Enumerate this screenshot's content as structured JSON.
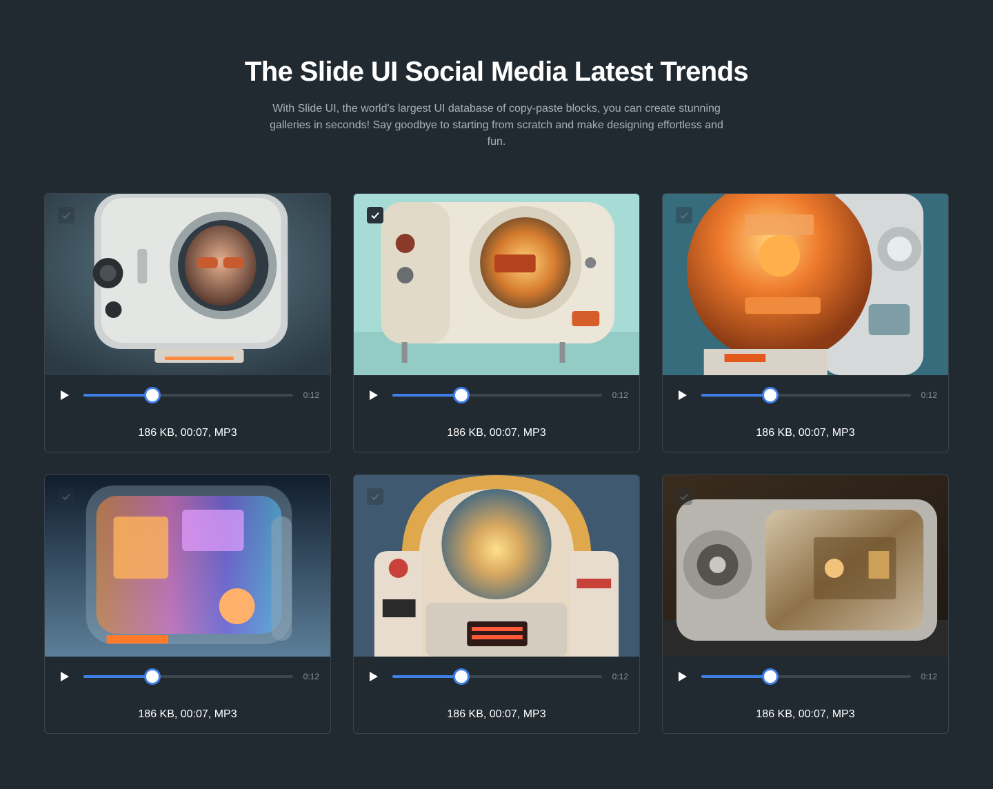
{
  "hero": {
    "title": "The Slide UI Social Media Latest Trends",
    "description": "With Slide UI, the world's largest UI database of copy-paste blocks, you can create stunning galleries in seconds! Say goodbye to starting from scratch and make designing effortless and fun."
  },
  "colors": {
    "background": "#222a31",
    "card_border": "#3b444c",
    "accent": "#3f80e8"
  },
  "cards": [
    {
      "image": "retro-tv-with-woman-face",
      "selected": false,
      "progress": 0.33,
      "duration": "0:12",
      "meta": "186 KB, 00:07, MP3"
    },
    {
      "image": "cream-retro-camera-machine",
      "selected": true,
      "progress": 0.33,
      "duration": "0:12",
      "meta": "186 KB, 00:07, MP3"
    },
    {
      "image": "orange-glass-robot-machine",
      "selected": false,
      "progress": 0.33,
      "duration": "0:12",
      "meta": "186 KB, 00:07, MP3"
    },
    {
      "image": "transparent-neon-circuit-box",
      "selected": false,
      "progress": 0.33,
      "duration": "0:12",
      "meta": "186 KB, 00:07, MP3"
    },
    {
      "image": "retro-jukebox-console",
      "selected": false,
      "progress": 0.33,
      "duration": "0:12",
      "meta": "186 KB, 00:07, MP3"
    },
    {
      "image": "chrome-glass-machine",
      "selected": false,
      "progress": 0.33,
      "duration": "0:12",
      "meta": "186 KB, 00:07, MP3"
    }
  ]
}
